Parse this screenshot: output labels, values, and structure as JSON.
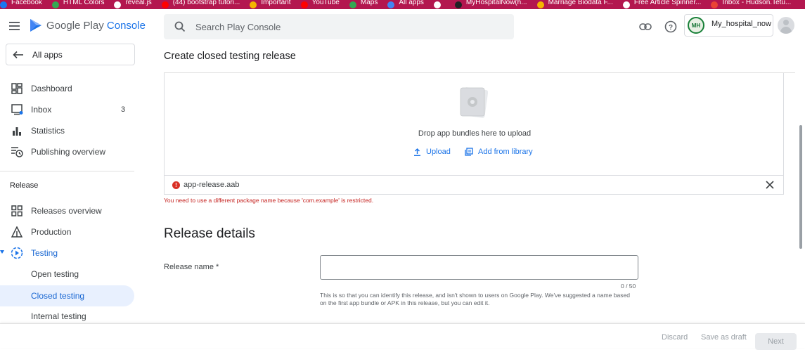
{
  "bookmarks": [
    {
      "label": "Facebook",
      "color": "#1877f2"
    },
    {
      "label": "HTML Colors",
      "color": "#34a853"
    },
    {
      "label": "reveal.js",
      "color": "#ffffff"
    },
    {
      "label": "(44) bootstrap tutori...",
      "color": "#ff0000"
    },
    {
      "label": "Important",
      "color": "#f4b400"
    },
    {
      "label": "YouTube",
      "color": "#ff0000"
    },
    {
      "label": "Maps",
      "color": "#34a853"
    },
    {
      "label": "All apps",
      "color": "#4285f4"
    },
    {
      "label": "",
      "color": "#ffffff"
    },
    {
      "label": "MyHospitalNow(h...",
      "color": "#202124"
    },
    {
      "label": "Marriage Biodata F...",
      "color": "#f4b400"
    },
    {
      "label": "Free Article Spinner...",
      "color": "#ffffff"
    },
    {
      "label": "Inbox - Hudson.Tetu...",
      "color": "#ea4335"
    }
  ],
  "header": {
    "logo_prefix": "Google Play ",
    "logo_suffix": "Console",
    "search_placeholder": "Search Play Console",
    "account_name": "My_hospital_now",
    "account_initials": "MH"
  },
  "sidebar": {
    "all_apps_label": "All apps",
    "items": [
      {
        "label": "Dashboard"
      },
      {
        "label": "Inbox",
        "badge": "3"
      },
      {
        "label": "Statistics"
      },
      {
        "label": "Publishing overview"
      }
    ],
    "section_label": "Release",
    "release_items": [
      {
        "label": "Releases overview"
      },
      {
        "label": "Production"
      },
      {
        "label": "Testing"
      },
      {
        "label": "Open testing"
      },
      {
        "label": "Closed testing"
      },
      {
        "label": "Internal testing"
      }
    ]
  },
  "main": {
    "page_title": "Create closed testing release",
    "drop_text": "Drop app bundles here to upload",
    "upload_label": "Upload",
    "library_label": "Add from library",
    "file_name": "app-release.aab",
    "error_message": "You need to use a different package name because 'com.example' is restricted.",
    "section_title": "Release details",
    "release_name_label": "Release name  *",
    "release_name_value": "",
    "char_count": "0 / 50",
    "helper_text": "This is so that you can identify this release, and isn't shown to users on Google Play. We've suggested a name based on the first app bundle or APK in this release, but you can edit it."
  },
  "footer": {
    "discard_label": "Discard",
    "draft_label": "Save as draft",
    "next_label": "Next"
  },
  "colors": {
    "accent": "#1a73e8",
    "error": "#d93025",
    "bookmark_bar": "#b3174f"
  }
}
